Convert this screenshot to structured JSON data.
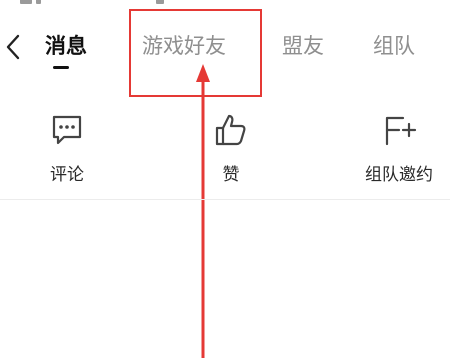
{
  "header": {
    "tabs": [
      {
        "label": "消息",
        "active": true
      },
      {
        "label": "游戏好友",
        "active": false
      },
      {
        "label": "盟友",
        "active": false
      },
      {
        "label": "组队",
        "active": false
      }
    ]
  },
  "actions": [
    {
      "label": "评论",
      "icon": "comment-icon"
    },
    {
      "label": "赞",
      "icon": "thumbs-up-icon"
    },
    {
      "label": "组队邀约",
      "icon": "team-invite-icon"
    }
  ],
  "colors": {
    "highlight": "#e53935",
    "active_text": "#111111",
    "inactive_text": "#8f8f8f"
  }
}
